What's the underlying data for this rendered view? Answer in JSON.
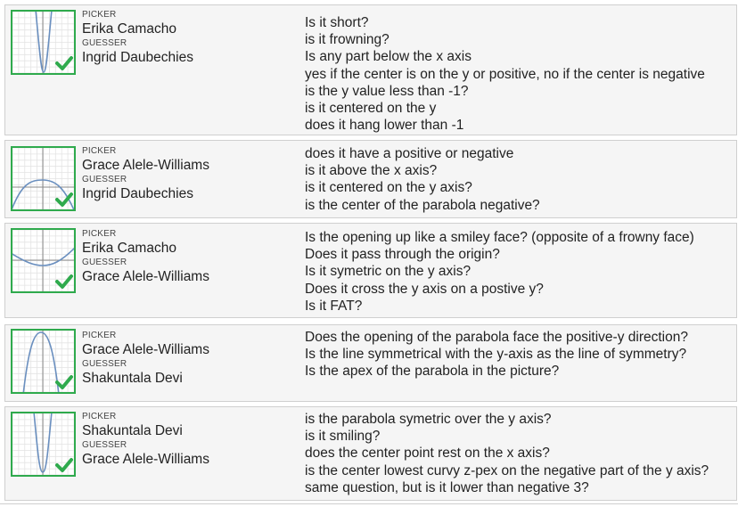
{
  "labels": {
    "picker": "PICKER",
    "guesser": "GUESSER"
  },
  "colors": {
    "check_green": "#2faa4d",
    "curve_blue": "#6a8fbf",
    "grid": "#e3e3e3"
  },
  "rounds": [
    {
      "picker": "Erika Camacho",
      "guesser": "Ingrid Daubechies",
      "correct": true,
      "questions": [
        "Is it short?",
        "is it frowning?",
        "Is any part below the x axis",
        "yes if the center is on the y or positive, no if the center is negative",
        "is the y value less than -1?",
        "is it centered on the y",
        "does it hang lower than -1"
      ]
    },
    {
      "picker": "Grace Alele-Williams",
      "guesser": "Ingrid Daubechies",
      "correct": true,
      "questions": [
        "does it have a positive or negative",
        "is it above the x axis?",
        "is it centered on the y axis?",
        "is the center of the parabola negative?"
      ]
    },
    {
      "picker": "Erika Camacho",
      "guesser": "Grace Alele-Williams",
      "correct": true,
      "questions": [
        "Is the opening up like a smiley face? (opposite of a frowny face)",
        "Does it pass through the origin?",
        "Is it symetric on the y axis?",
        "Does it cross the y axis on a postive y?",
        "Is it FAT?"
      ]
    },
    {
      "picker": "Grace Alele-Williams",
      "guesser": "Shakuntala Devi",
      "correct": true,
      "questions": [
        "Does the opening of the parabola face the positive-y direction?",
        "Is the line symmetrical with the y-axis as the line of symmetry?",
        "Is the apex of the parabola in the picture?"
      ]
    },
    {
      "picker": "Shakuntala Devi",
      "guesser": "Grace Alele-Williams",
      "correct": true,
      "questions": [
        "is the parabola symetric over the y axis?",
        "is it smiling?",
        "does the center point rest on the x axis?",
        "is the center lowest curvy z-pex on the negative part of the y axis?",
        "same question, but is it lower than negative 3?"
      ]
    }
  ]
}
